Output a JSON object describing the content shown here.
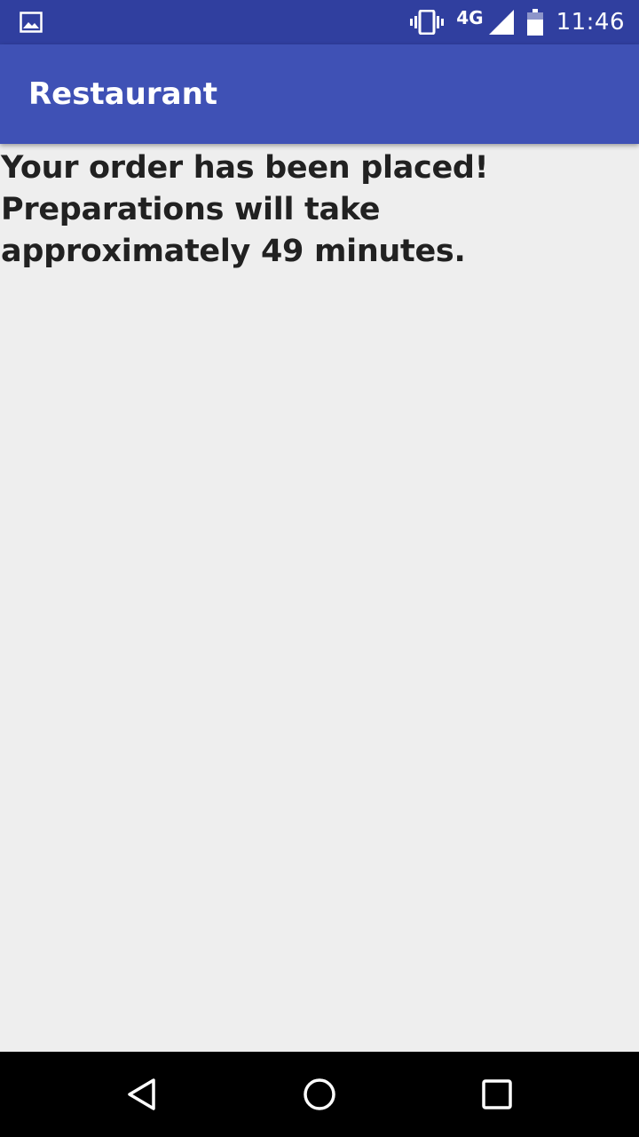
{
  "status_bar": {
    "notification_icon": "image-icon",
    "vibrate_icon": "vibrate-icon",
    "network_type": "4G",
    "signal_icon": "signal-icon",
    "battery_icon": "battery-icon",
    "time": "11:46"
  },
  "app_bar": {
    "title": "Restaurant"
  },
  "content": {
    "line1": "Your order has been placed!",
    "line2": "Preparations will take approximately 49 minutes."
  },
  "nav_bar": {
    "back_icon": "back-triangle-icon",
    "home_icon": "home-circle-icon",
    "recents_icon": "recents-square-icon"
  },
  "colors": {
    "status_bar": "#303f9f",
    "app_bar": "#3f51b5",
    "background": "#eeeeee",
    "text": "#212121",
    "nav_bar": "#000000"
  }
}
